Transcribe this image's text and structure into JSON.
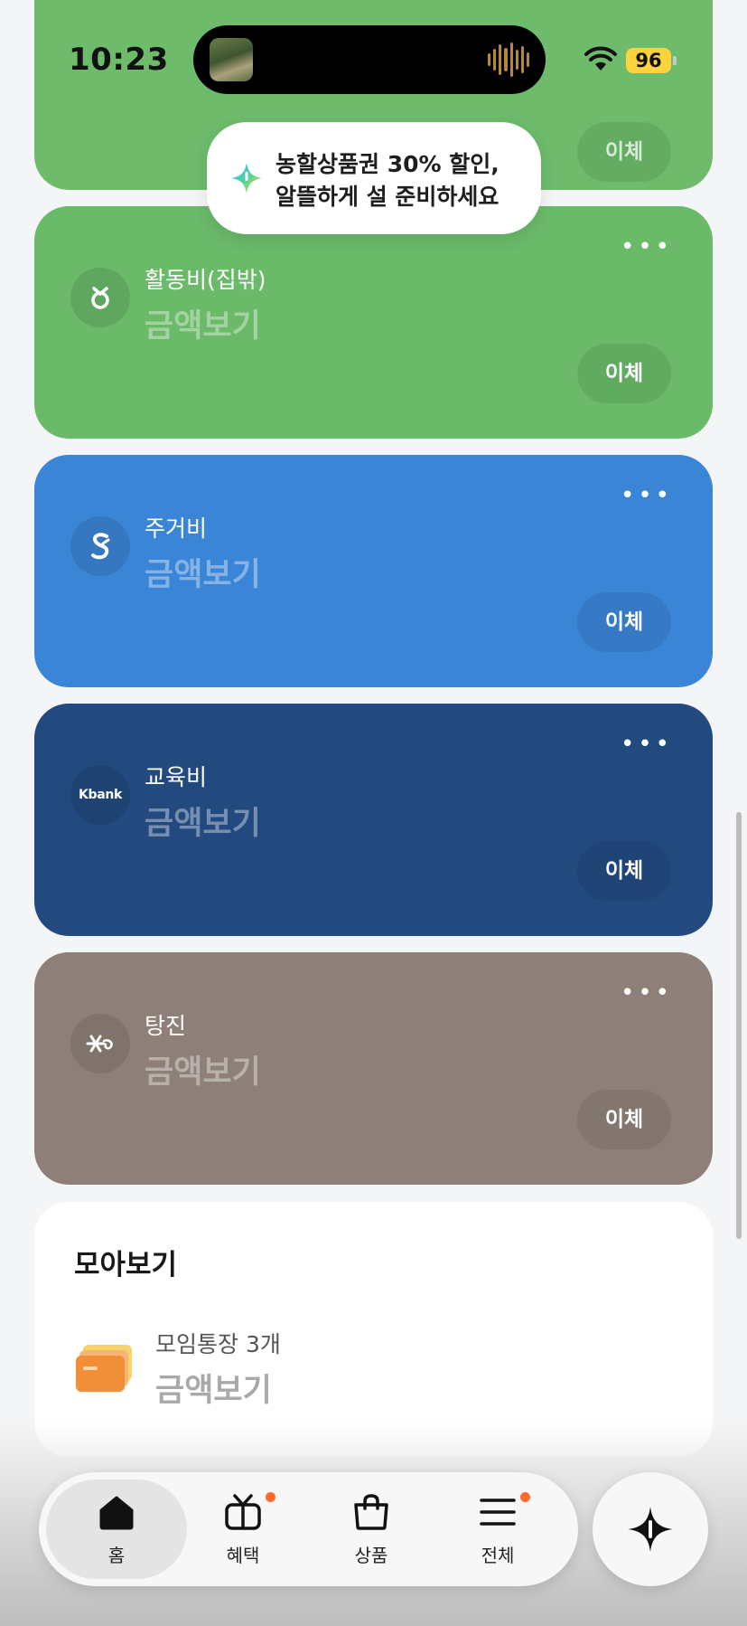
{
  "status_bar": {
    "time": "10:23",
    "battery": "96"
  },
  "toast": {
    "line1": "농할상품권 30% 할인,",
    "line2": "알뜰하게 설 준비하세요"
  },
  "cards": [
    {
      "name": "",
      "amount": "",
      "button": "이체",
      "color": "#6ebb6c"
    },
    {
      "name": "활동비(집밖)",
      "amount": "금액보기",
      "button": "이체",
      "icon": "bank-logo-icon",
      "color": "#6aba6a"
    },
    {
      "name": "주거비",
      "amount": "금액보기",
      "button": "이체",
      "icon": "bank-logo-icon",
      "color": "#3b85d6"
    },
    {
      "name": "교육비",
      "amount": "금액보기",
      "button": "이체",
      "icon": "Kbank",
      "color": "#224a7f"
    },
    {
      "name": "탕진",
      "amount": "금액보기",
      "button": "이체",
      "icon": "bank-logo-icon",
      "color": "#8e8078"
    }
  ],
  "summary": {
    "title": "모아보기",
    "item_name": "모임통장 3개",
    "item_amount": "금액보기"
  },
  "tabbar": {
    "tabs": [
      {
        "label": "홈",
        "icon": "home-icon",
        "active": true
      },
      {
        "label": "혜택",
        "icon": "gift-icon",
        "badge": true
      },
      {
        "label": "상품",
        "icon": "shopping-bag-icon"
      },
      {
        "label": "전체",
        "icon": "menu-icon",
        "badge": true
      }
    ]
  },
  "colors": {
    "accent_badge": "#ff6a2b",
    "battery": "#ffd33d"
  }
}
